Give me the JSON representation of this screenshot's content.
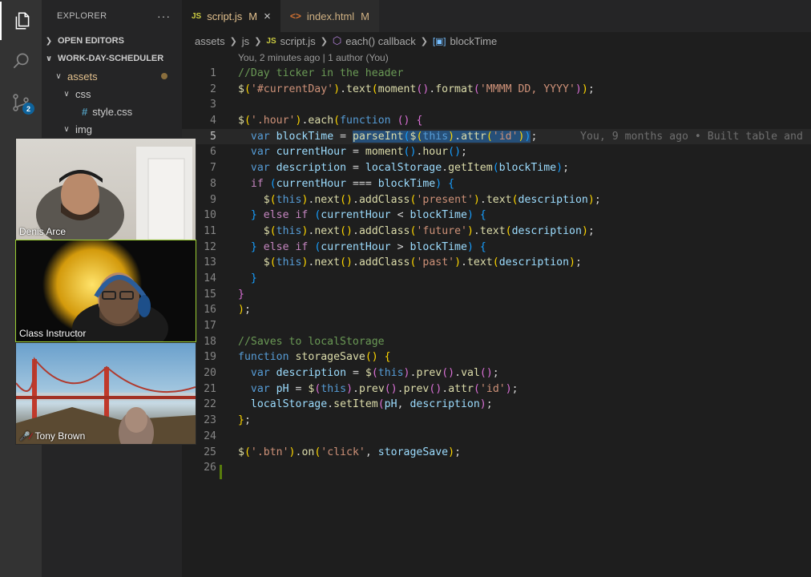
{
  "sidebar": {
    "title": "EXPLORER",
    "more": "···",
    "open_editors": "OPEN EDITORS",
    "project": "WORK-DAY-SCHEDULER",
    "tree": {
      "assets": "assets",
      "css": "css",
      "style_css": "style.css",
      "img": "img"
    }
  },
  "activity": {
    "scm_badge": "2"
  },
  "tabs": [
    {
      "label": "script.js",
      "status": "M",
      "icon": "JS"
    },
    {
      "label": "index.html",
      "status": "M",
      "icon": "<>"
    }
  ],
  "breadcrumb": [
    "assets",
    "js",
    "script.js",
    "each() callback",
    "blockTime"
  ],
  "codelens": "You, 2 minutes ago | 1 author (You)",
  "editor": {
    "current_line": 5,
    "blame": "You, 9 months ago • Built table and"
  },
  "video": [
    {
      "name": "Denis Arce",
      "muted": false
    },
    {
      "name": "Class Instructor",
      "muted": false,
      "active_speaker": true
    },
    {
      "name": "Tony Brown",
      "muted": true
    }
  ]
}
